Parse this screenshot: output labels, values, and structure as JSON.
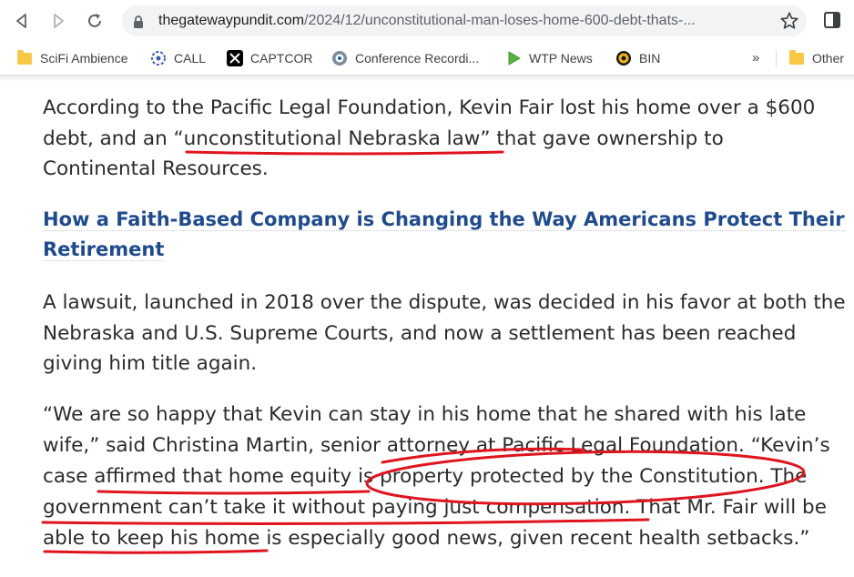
{
  "browser": {
    "url_domain": "thegatewaypundit.com",
    "url_path": "/2024/12/unconstitutional-man-loses-home-600-debt-thats-...",
    "icons": [
      "back-arrow-icon",
      "forward-arrow-icon",
      "reload-icon",
      "lock-icon",
      "star-icon",
      "side-panel-icon"
    ]
  },
  "bookmarks": {
    "items": [
      {
        "label": "SciFi Ambience",
        "icon": "folder-icon"
      },
      {
        "label": "CALL",
        "icon": "call-icon"
      },
      {
        "label": "CAPTCOR",
        "icon": "x-logo-icon"
      },
      {
        "label": "Conference Recordi...",
        "icon": "conference-icon"
      },
      {
        "label": "WTP News",
        "icon": "play-icon"
      },
      {
        "label": "BIN",
        "icon": "bin-icon"
      }
    ],
    "overflow": "»",
    "other_label": "Other"
  },
  "article": {
    "p1": [
      "According to the Pacific Legal Foundation, Kevin Fair lost his home over a $600",
      "debt, and an “unconstitutional Nebraska law” that gave ownership to",
      "Continental Resources."
    ],
    "heading": [
      "How a Faith-Based Company is Changing the Way Americans Protect Their",
      "Retirement"
    ],
    "p2": [
      "A lawsuit, launched in 2018 over the dispute, was decided in his favor at both the",
      "Nebraska and U.S. Supreme Courts, and now a settlement has been reached",
      "giving him title again."
    ],
    "p3": [
      "“We are so happy that Kevin can stay in his home that he shared with his late",
      "wife,” said Christina Martin, senior attorney at Pacific Legal Foundation. “Kevin’s",
      "case affirmed that home equity is property protected by the Constitution. The",
      "government can’t take it without paying just compensation. That Mr. Fair will be",
      "able to keep his home is especially good news, given recent health setbacks.”"
    ]
  },
  "annotation_color": "#e0141e"
}
